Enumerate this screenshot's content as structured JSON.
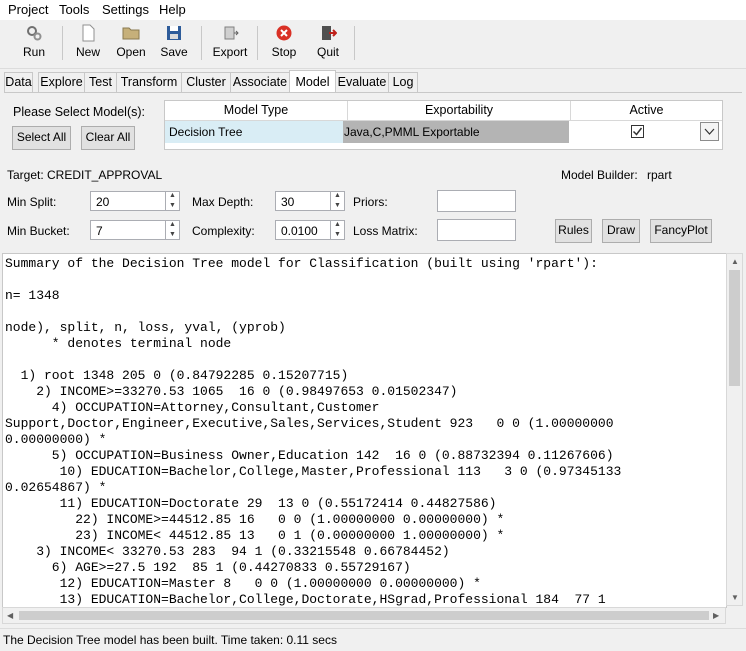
{
  "menu": [
    "Project",
    "Tools",
    "Settings",
    "Help"
  ],
  "toolbar": {
    "run": "Run",
    "new": "New",
    "open": "Open",
    "save": "Save",
    "export": "Export",
    "stop": "Stop",
    "quit": "Quit"
  },
  "tabs": [
    "Data",
    "Explore",
    "Test",
    "Transform",
    "Cluster",
    "Associate",
    "Model",
    "Evaluate",
    "Log"
  ],
  "active_tab": "Model",
  "model_select": {
    "prompt": "Please Select Model(s):",
    "select_all": "Select All",
    "clear_all": "Clear All",
    "headers": [
      "Model Type",
      "Exportability",
      "Active"
    ],
    "row": {
      "type": "Decision Tree",
      "exportability": "Java,C,PMML Exportable",
      "active": true
    }
  },
  "target": "Target: CREDIT_APPROVAL",
  "model_builder_label": "Model Builder:",
  "model_builder_value": "rpart",
  "params": {
    "min_split_label": "Min Split:",
    "min_split": "20",
    "max_depth_label": "Max Depth:",
    "max_depth": "30",
    "priors_label": "Priors:",
    "priors": "",
    "min_bucket_label": "Min Bucket:",
    "min_bucket": "7",
    "complexity_label": "Complexity:",
    "complexity": "0.0100",
    "loss_matrix_label": "Loss Matrix:",
    "loss_matrix": ""
  },
  "actions": {
    "rules": "Rules",
    "draw": "Draw",
    "fancyplot": "FancyPlot"
  },
  "output_lines": [
    "Summary of the Decision Tree model for Classification (built using 'rpart'):",
    "",
    "n= 1348",
    "",
    "node), split, n, loss, yval, (yprob)",
    "      * denotes terminal node",
    "",
    "  1) root 1348 205 0 (0.84792285 0.15207715)",
    "    2) INCOME>=33270.53 1065  16 0 (0.98497653 0.01502347)",
    "      4) OCCUPATION=Attorney,Consultant,Customer",
    "Support,Doctor,Engineer,Executive,Sales,Services,Student 923   0 0 (1.00000000",
    "0.00000000) *",
    "      5) OCCUPATION=Business Owner,Education 142  16 0 (0.88732394 0.11267606)",
    "       10) EDUCATION=Bachelor,College,Master,Professional 113   3 0 (0.97345133",
    "0.02654867) *",
    "       11) EDUCATION=Doctorate 29  13 0 (0.55172414 0.44827586)",
    "         22) INCOME>=44512.85 16   0 0 (1.00000000 0.00000000) *",
    "         23) INCOME< 44512.85 13   0 1 (0.00000000 1.00000000) *",
    "    3) INCOME< 33270.53 283  94 1 (0.33215548 0.66784452)",
    "      6) AGE>=27.5 192  85 1 (0.44270833 0.55729167)",
    "       12) EDUCATION=Master 8   0 0 (1.00000000 0.00000000) *",
    "       13) EDUCATION=Bachelor,College,Doctorate,HSgrad,Professional 184  77 1"
  ],
  "status": "The Decision Tree model has been built. Time taken: 0.11 secs"
}
